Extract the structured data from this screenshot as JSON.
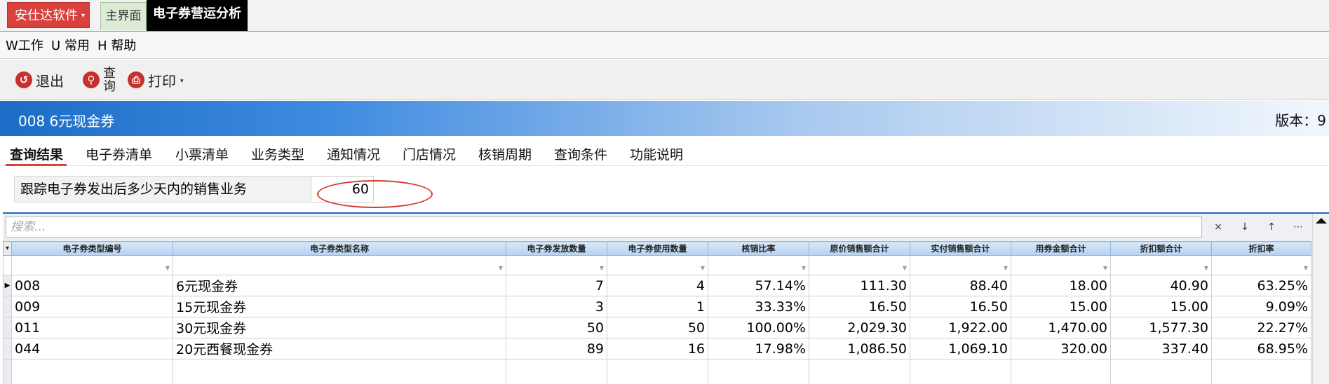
{
  "topbar": {
    "brand_label": "安仕达软件",
    "main_tab_label": "主界面",
    "active_tab_label": "电子券营运分析"
  },
  "menu": {
    "items": [
      "W工作",
      "U 常用",
      "H 帮助"
    ]
  },
  "toolbar": {
    "exit_label": "退出",
    "query_label_top": "查",
    "query_label_bottom": "询",
    "print_label": "打印"
  },
  "header": {
    "title": "008  6元现金券",
    "version": "版本：9"
  },
  "subtabs": [
    "查询结果",
    "电子券清单",
    "小票清单",
    "业务类型",
    "通知情况",
    "门店情况",
    "核销周期",
    "查询条件",
    "功能说明"
  ],
  "param": {
    "label": "跟踪电子券发出后多少天内的销售业务",
    "value": "60"
  },
  "grid": {
    "search_placeholder": "搜索...",
    "buttons": [
      "×",
      "↓",
      "↑",
      "⋯"
    ],
    "columns": [
      "电子券类型编号",
      "电子券类型名称",
      "电子券发放数量",
      "电子券使用数量",
      "核销比率",
      "原价销售额合计",
      "实付销售额合计",
      "用券金额合计",
      "折扣额合计",
      "折扣率"
    ],
    "rows": [
      [
        "008",
        "6元现金券",
        "7",
        "4",
        "57.14%",
        "111.30",
        "88.40",
        "18.00",
        "40.90",
        "63.25%"
      ],
      [
        "009",
        "15元现金券",
        "3",
        "1",
        "33.33%",
        "16.50",
        "16.50",
        "15.00",
        "15.00",
        "9.09%"
      ],
      [
        "011",
        "30元现金券",
        "50",
        "50",
        "100.00%",
        "2,029.30",
        "1,922.00",
        "1,470.00",
        "1,577.30",
        "22.27%"
      ],
      [
        "044",
        "20元西餐现金券",
        "89",
        "16",
        "17.98%",
        "1,086.50",
        "1,069.10",
        "320.00",
        "337.40",
        "68.95%"
      ]
    ]
  },
  "colors": {
    "brand_red": "#d9413d",
    "header_blue": "#1b6dc6",
    "annotation_red": "#d43a2a"
  }
}
